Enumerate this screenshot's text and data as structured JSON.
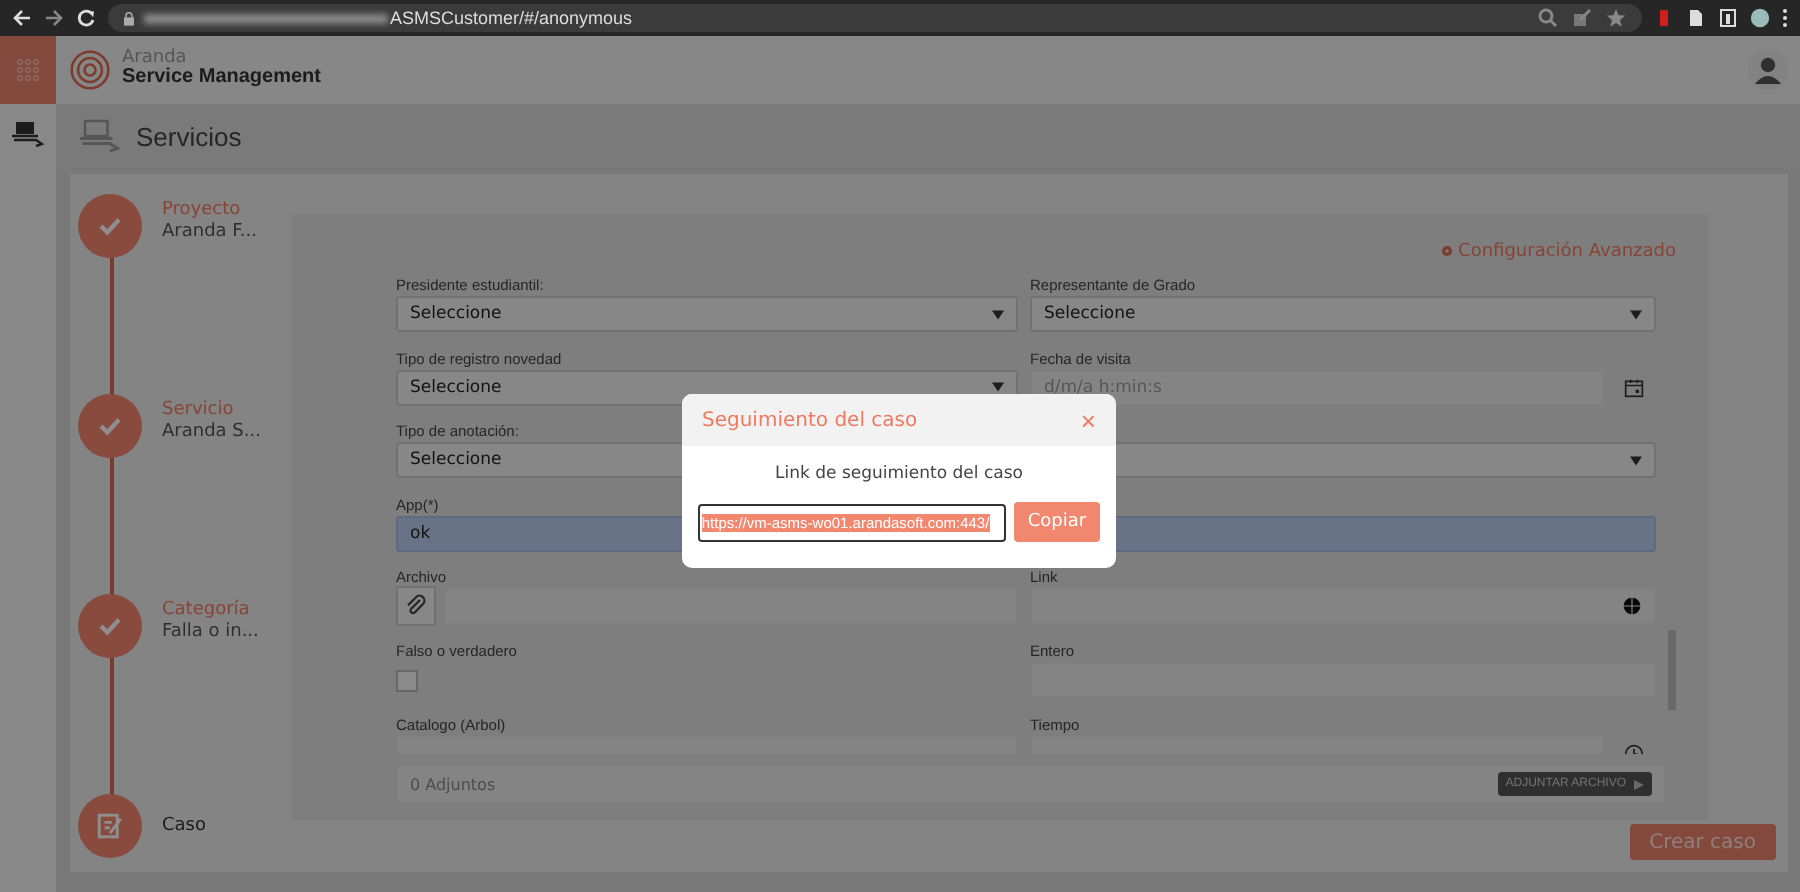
{
  "browser": {
    "url_path": "ASMSCustomer/#/anonymous"
  },
  "app": {
    "brand_top": "Aranda",
    "brand_bottom": "Service Management"
  },
  "page_title": "Servicios",
  "steps": [
    {
      "kind": "done",
      "title": "Proyecto",
      "subtitle": "Aranda F..."
    },
    {
      "kind": "done",
      "title": "Servicio",
      "subtitle": "Aranda S..."
    },
    {
      "kind": "done",
      "title": "Categoría",
      "subtitle": "Falla o in..."
    },
    {
      "kind": "current",
      "title": "Caso"
    }
  ],
  "advanced_link": "Configuración Avanzado",
  "fields": [
    {
      "kind": "select",
      "label": "Presidente estudiantil:",
      "value": "Seleccione"
    },
    {
      "kind": "select",
      "label": "Representante de Grado",
      "value": "Seleccione"
    },
    {
      "kind": "select",
      "label": "Tipo de registro novedad",
      "value": "Seleccione"
    },
    {
      "kind": "date",
      "label": "Fecha de visita",
      "placeholder": "d/m/a h:min:s"
    },
    {
      "kind": "select",
      "label": "Tipo de anotación:",
      "value": "Seleccione"
    },
    {
      "kind": "select"
    },
    {
      "kind": "text",
      "label": "App(*)",
      "value": "ok",
      "required": true
    },
    {
      "kind": "text",
      "required": true
    },
    {
      "kind": "file",
      "label": "Archivo"
    },
    {
      "kind": "link",
      "label": "Link"
    },
    {
      "kind": "checkbox",
      "label": "Falso o verdadero",
      "checked": false
    },
    {
      "kind": "text",
      "label": "Entero",
      "required": false
    },
    {
      "kind": "text",
      "label": "Catalogo (Arbol)",
      "required": false
    },
    {
      "kind": "time",
      "label": "Tiempo"
    }
  ],
  "attachments": {
    "count": "0 Adjuntos",
    "button": "ADJUNTAR ARCHIVO"
  },
  "create_button": "Crear caso",
  "dialog": {
    "title": "Seguimiento del caso",
    "close": "×",
    "message": "Link de seguimiento del caso",
    "link": "https://vm-asms-wo01.arandasoft.com:443/",
    "copy_button": "Copiar"
  }
}
